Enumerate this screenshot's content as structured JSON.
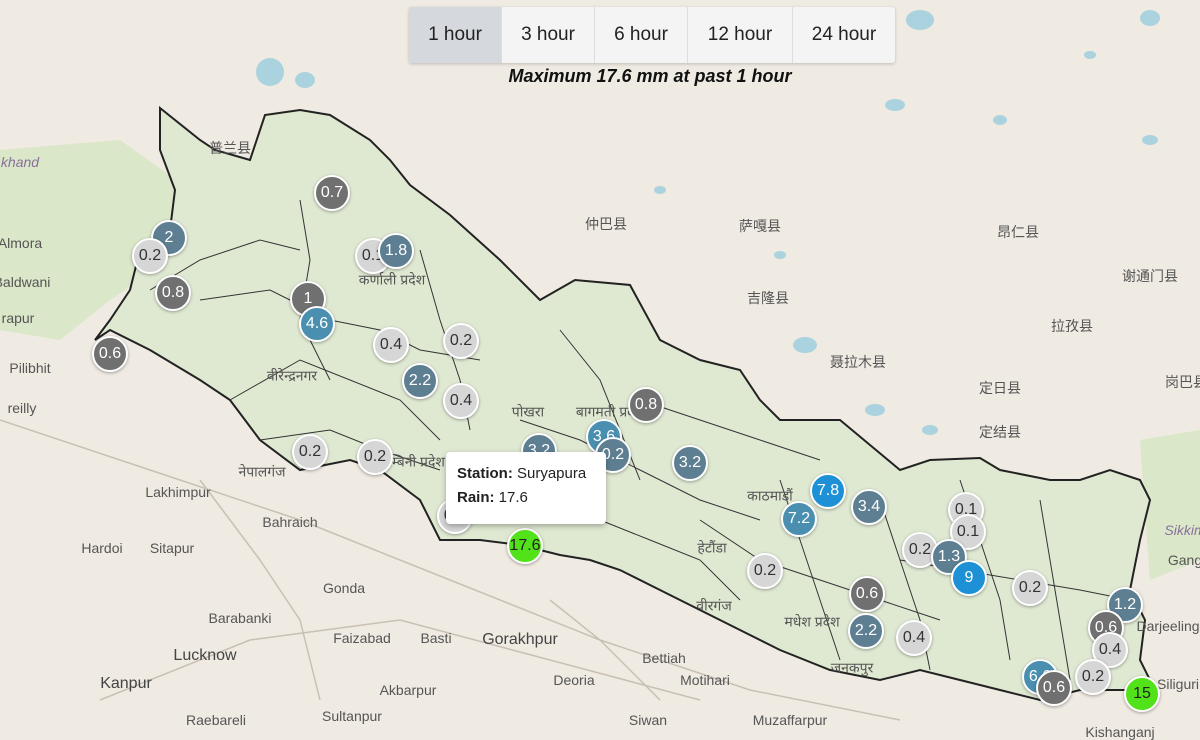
{
  "tabs": [
    {
      "label": "1 hour",
      "active": true
    },
    {
      "label": "3 hour",
      "active": false
    },
    {
      "label": "6 hour",
      "active": false
    },
    {
      "label": "12 hour",
      "active": false
    },
    {
      "label": "24 hour",
      "active": false
    }
  ],
  "caption": "Maximum 17.6 mm at past 1 hour",
  "tooltip": {
    "station_label": "Station:",
    "station_value": "Suryapura",
    "rain_label": "Rain:",
    "rain_value": "17.6"
  },
  "colors": {
    "light": "#d6d6d6",
    "gray": "#707070",
    "slate": "#5e7f92",
    "teal": "#4a8fb0",
    "blue": "#1e90d6",
    "green": "#52e21a",
    "nepal_land": "#dfe9d2",
    "land": "#efeae2",
    "water": "#aad3df"
  },
  "places": [
    "Almora",
    "Baldwani",
    "rapur",
    "Pilibhit",
    "reilly",
    "Lakhimpur",
    "Bahraich",
    "Hardoi",
    "Sitapur",
    "Gonda",
    "Barabanki",
    "Lucknow",
    "Faizabad",
    "Basti",
    "Gorakhpur",
    "Kanpur",
    "Akbarpur",
    "Raebareli",
    "Sultanpur",
    "Deoria",
    "Bettiah",
    "Motihari",
    "Siwan",
    "Muzaffarpur",
    "Kishanganj",
    "Siliguri",
    "Darjeeling",
    "Gang",
    "Sikkim",
    "khand",
    "仲巴县",
    "萨嘎县",
    "吉隆县",
    "聂拉木县",
    "定日县",
    "定结县",
    "拉孜县",
    "昂仁县",
    "谢通门县",
    "岗巴县",
    "普兰县",
    "कर्णाली प्रदेश",
    "लुम्बिनी प्रदेश",
    "बागमती प्रदेश",
    "मधेश प्रदेश",
    "काठमाडौं",
    "हेटौंडा",
    "वीरगंज",
    "जनकपुर",
    "नेपालगंज",
    "वीरेन्द्रनगर",
    "पोखरा"
  ],
  "stations": [
    {
      "value": "0.7",
      "color": "gray"
    },
    {
      "value": "2",
      "color": "slate"
    },
    {
      "value": "0.2",
      "color": "light"
    },
    {
      "value": "0.8",
      "color": "gray"
    },
    {
      "value": "0.6",
      "color": "gray"
    },
    {
      "value": "0.1",
      "color": "light"
    },
    {
      "value": "1.8",
      "color": "slate"
    },
    {
      "value": "1",
      "color": "gray"
    },
    {
      "value": "4.6",
      "color": "teal"
    },
    {
      "value": "0.4",
      "color": "light"
    },
    {
      "value": "0.2",
      "color": "light"
    },
    {
      "value": "2.2",
      "color": "slate"
    },
    {
      "value": "0.4",
      "color": "light"
    },
    {
      "value": "0.2",
      "color": "light"
    },
    {
      "value": "0.2",
      "color": "light"
    },
    {
      "value": "0.2",
      "color": "light"
    },
    {
      "value": "3.2",
      "color": "slate"
    },
    {
      "value": "3.6",
      "color": "teal"
    },
    {
      "value": "0.2",
      "color": "slate"
    },
    {
      "value": "0.8",
      "color": "gray"
    },
    {
      "value": "3.2",
      "color": "slate"
    },
    {
      "value": "17.6",
      "color": "green"
    },
    {
      "value": "7.8",
      "color": "blue"
    },
    {
      "value": "7.2",
      "color": "teal"
    },
    {
      "value": "3.4",
      "color": "slate"
    },
    {
      "value": "0.2",
      "color": "light"
    },
    {
      "value": "0.6",
      "color": "gray"
    },
    {
      "value": "2.2",
      "color": "slate"
    },
    {
      "value": "0.4",
      "color": "light"
    },
    {
      "value": "0.1",
      "color": "light"
    },
    {
      "value": "0.1",
      "color": "light"
    },
    {
      "value": "0.2",
      "color": "light"
    },
    {
      "value": "1.3",
      "color": "slate"
    },
    {
      "value": "9",
      "color": "blue"
    },
    {
      "value": "0.2",
      "color": "light"
    },
    {
      "value": "1.2",
      "color": "slate"
    },
    {
      "value": "0.6",
      "color": "gray"
    },
    {
      "value": "0.4",
      "color": "light"
    },
    {
      "value": "6.6",
      "color": "teal"
    },
    {
      "value": "0.6",
      "color": "gray"
    },
    {
      "value": "0.2",
      "color": "light"
    },
    {
      "value": "15",
      "color": "green"
    }
  ]
}
